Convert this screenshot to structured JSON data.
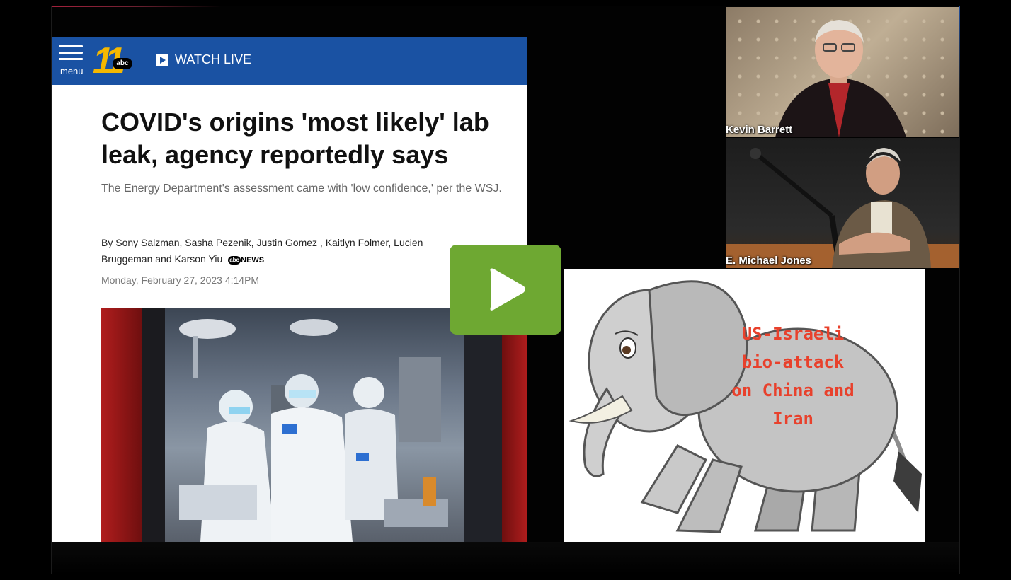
{
  "article": {
    "header": {
      "menu_label": "menu",
      "logo_number": "11",
      "logo_bug": "abc",
      "watch_live_label": "WATCH LIVE"
    },
    "headline": "COVID's origins 'most likely' lab leak, agency reportedly says",
    "subhead": "The Energy Department's assessment came with 'low confidence,' per the WSJ.",
    "byline": "By Sony Salzman, Sasha Pezenik, Justin Gomez , Kaitlyn Folmer, Lucien Bruggeman and Karson Yiu",
    "byline_logo_bug": "abc",
    "byline_logo_text": "NEWS",
    "date": "Monday, February 27, 2023 4:14PM"
  },
  "video_tiles": {
    "top_name": "Kevin Barrett",
    "bottom_name": "E. Michael Jones"
  },
  "elephant": {
    "caption_lines": [
      "US-Israeli",
      "bio-attack",
      "on China and",
      "Iran"
    ],
    "caption_color": "#e8412c"
  },
  "colors": {
    "header_blue": "#1a52a3",
    "play_green": "#6ea832",
    "logo_yellow": "#f5b800"
  }
}
